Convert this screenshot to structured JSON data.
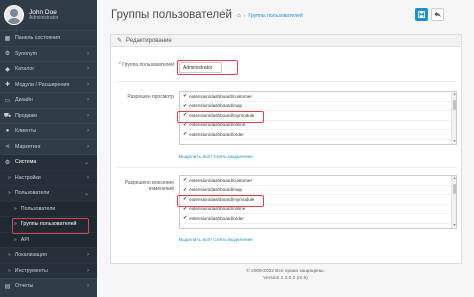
{
  "sidebar": {
    "user_name": "John Doe",
    "user_role": "Administrator",
    "items": [
      {
        "label": "Панель состояния",
        "icon": "dashboard-icon",
        "arrow": ""
      },
      {
        "label": "Synonym",
        "icon": "gear-icon",
        "arrow": "›"
      },
      {
        "label": "Каталог",
        "icon": "tag-icon",
        "arrow": "›"
      },
      {
        "label": "Модули / Расширения",
        "icon": "puzzle-icon",
        "arrow": "›"
      },
      {
        "label": "Дизайн",
        "icon": "monitor-icon",
        "arrow": "›"
      },
      {
        "label": "Продажи",
        "icon": "cart-icon",
        "arrow": "›"
      },
      {
        "label": "Клиенты",
        "icon": "user-icon",
        "arrow": "›"
      },
      {
        "label": "Маркетинг",
        "icon": "share-icon",
        "arrow": "›"
      },
      {
        "label": "Система",
        "icon": "cog-icon",
        "arrow": "⌄"
      }
    ],
    "sub_settings": "Настройки",
    "sub_users": "Пользователи",
    "sub2_users": "Пользователи",
    "sub2_groups": "Группы пользователей",
    "sub2_api": "API",
    "sub_localisation": "Локализация",
    "sub_tools": "Инструменты",
    "reports": "Отчеты"
  },
  "header": {
    "title": "Группы пользователей",
    "breadcrumb": "Группы пользователей"
  },
  "panel": {
    "heading": "Редактирование",
    "name_label": "Группа пользователей",
    "name_value": "Administrator",
    "access_label": "Разрешен просмотр",
    "modify_label": "Разрешено внесение изменений",
    "access_options": [
      "extension/dashboard/customer",
      "extension/dashboard/map",
      "extension/dashboard/mymodule",
      "extension/dashboard/online",
      "extension/dashboard/order"
    ],
    "modify_options": [
      "extension/dashboard/customer",
      "extension/dashboard/map",
      "extension/dashboard/mymodule",
      "extension/dashboard/online",
      "extension/dashboard/order"
    ],
    "select_all": "Выделить всё",
    "unselect_all": "Снять выделение"
  },
  "footer": {
    "line1": "© 2009-2022 Все права защищены.",
    "line2": "Version 2.3.0.2 (rs.5)"
  },
  "colors": {
    "sidebar_bg": "#2f3b46",
    "accent": "#1e91cf",
    "highlight": "#d9434f"
  }
}
